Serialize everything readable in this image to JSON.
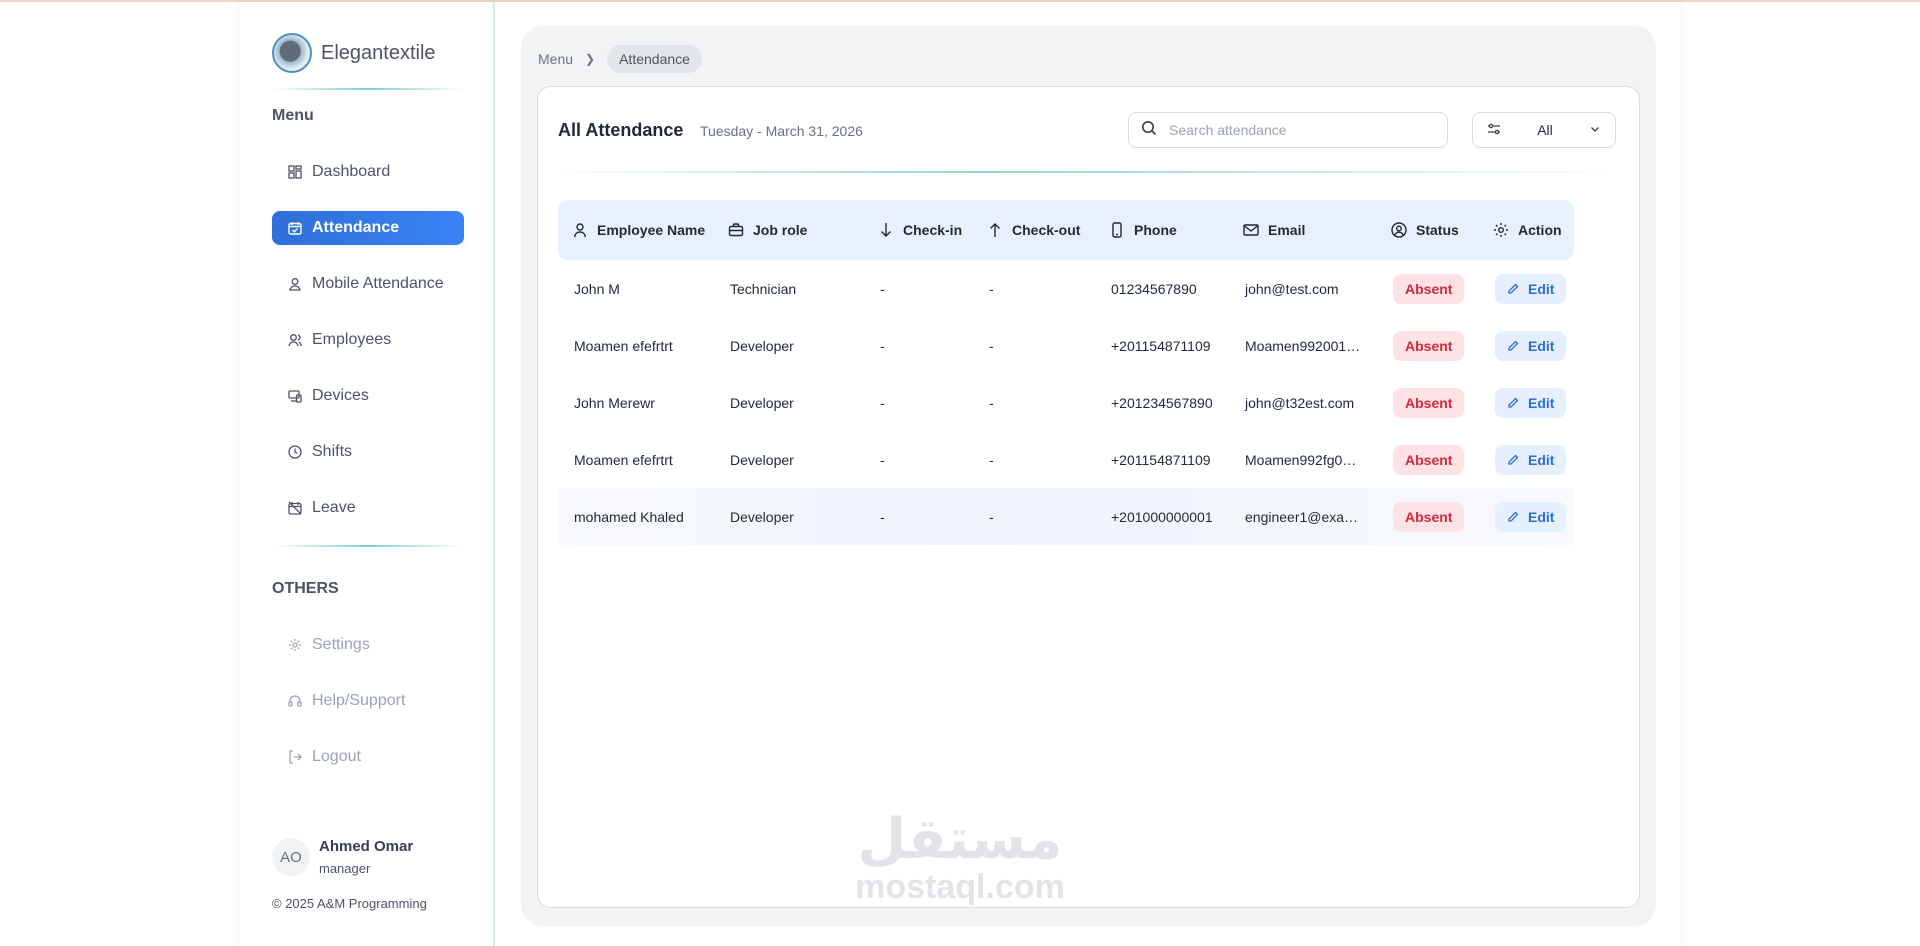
{
  "brand": {
    "name": "Elegantextile"
  },
  "sidebar": {
    "menu_label": "Menu",
    "items": [
      {
        "label": "Dashboard",
        "icon": "dashboard-icon"
      },
      {
        "label": "Attendance",
        "icon": "calendar-check-icon",
        "active": true
      },
      {
        "label": "Mobile Attendance",
        "icon": "location-person-icon"
      },
      {
        "label": "Employees",
        "icon": "users-icon"
      },
      {
        "label": "Devices",
        "icon": "devices-icon"
      },
      {
        "label": "Shifts",
        "icon": "clock-icon"
      },
      {
        "label": "Leave",
        "icon": "calendar-off-icon"
      }
    ],
    "others_label": "OTHERS",
    "others": [
      {
        "label": "Settings",
        "icon": "gear-icon"
      },
      {
        "label": "Help/Support",
        "icon": "headset-icon"
      },
      {
        "label": "Logout",
        "icon": "logout-icon"
      }
    ],
    "user": {
      "initials": "AO",
      "name": "Ahmed Omar",
      "role": "manager"
    },
    "copyright": "© 2025 A&M Programming"
  },
  "breadcrumb": {
    "root": "Menu",
    "current": "Attendance"
  },
  "card": {
    "title": "All Attendance",
    "date": "Tuesday - March 31, 2026",
    "search_placeholder": "Search attendance",
    "filter_value": "All"
  },
  "table": {
    "columns": [
      "Employee Name",
      "Job role",
      "Check-in",
      "Check-out",
      "Phone",
      "Email",
      "Status",
      "Action"
    ],
    "rows": [
      {
        "name": "John M",
        "role": "Technician",
        "checkin": "-",
        "checkout": "-",
        "phone": "01234567890",
        "email": "john@test.com",
        "status": "Absent",
        "action": "Edit"
      },
      {
        "name": "Moamen efefrtrt",
        "role": "Developer",
        "checkin": "-",
        "checkout": "-",
        "phone": "+201154871109",
        "email": "Moamen992001…",
        "status": "Absent",
        "action": "Edit"
      },
      {
        "name": "John Merewr",
        "role": "Developer",
        "checkin": "-",
        "checkout": "-",
        "phone": "+201234567890",
        "email": "john@t32est.com",
        "status": "Absent",
        "action": "Edit"
      },
      {
        "name": "Moamen efefrtrt",
        "role": "Developer",
        "checkin": "-",
        "checkout": "-",
        "phone": "+201154871109",
        "email": "Moamen992fg0…",
        "status": "Absent",
        "action": "Edit"
      },
      {
        "name": "mohamed Khaled",
        "role": "Developer",
        "checkin": "-",
        "checkout": "-",
        "phone": "+201000000001",
        "email": "engineer1@exa…",
        "status": "Absent",
        "action": "Edit"
      }
    ]
  },
  "watermark": {
    "arabic": "مستقل",
    "latin": "mostaql.com"
  },
  "colors": {
    "accent": "#2f6fd6",
    "absent": "#d5283c",
    "header_bg": "#e8f0fd",
    "teal_line": "#7fcfcc"
  }
}
